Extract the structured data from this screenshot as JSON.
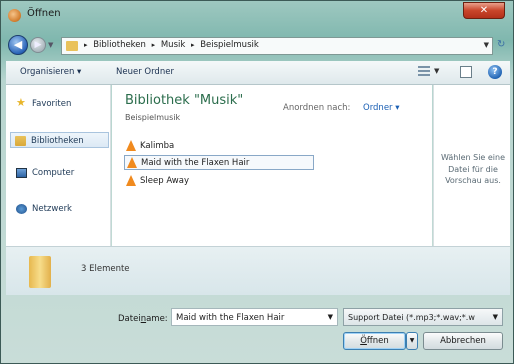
{
  "window": {
    "title": "Öffnen",
    "close_label": "✕"
  },
  "address": {
    "crumbs": [
      "Bibliotheken",
      "Musik",
      "Beispielmusik"
    ],
    "separator": "▸"
  },
  "toolbar": {
    "organize_label": "Organisieren ▾",
    "new_folder_label": "Neuer Ordner",
    "help_label": "?"
  },
  "sidebar": {
    "items": [
      {
        "label": "Favoriten",
        "icon": "star-icon"
      },
      {
        "label": "Bibliotheken",
        "icon": "library-icon",
        "selected": true
      },
      {
        "label": "Computer",
        "icon": "computer-icon"
      },
      {
        "label": "Netzwerk",
        "icon": "network-icon"
      }
    ]
  },
  "main": {
    "library_title": "Bibliothek \"Musik\"",
    "library_subtitle": "Beispielmusik",
    "arrange_label": "Anordnen nach:",
    "arrange_value": "Ordner ▾",
    "files": [
      {
        "name": "Kalimba",
        "selected": false
      },
      {
        "name": "Maid with the Flaxen Hair",
        "selected": true
      },
      {
        "name": "Sleep Away",
        "selected": false
      }
    ]
  },
  "preview": {
    "text": "Wählen Sie eine Datei für die Vorschau aus."
  },
  "details": {
    "count": "3 Elemente"
  },
  "bottom": {
    "filename_label_prefix": "Datei",
    "filename_label_underlined": "n",
    "filename_label_suffix": "ame:",
    "filename_value": "Maid with the Flaxen Hair",
    "filetype_value": "Support Datei (*.mp3;*.wav;*.w",
    "open_label_underlined": "Ö",
    "open_label_rest": "ffnen",
    "cancel_label": "Abbrechen"
  },
  "colors": {
    "accent": "#2b6d4c",
    "link": "#1a5fb4",
    "close_button": "#c9452a",
    "file_icon": "#f08a1e"
  }
}
